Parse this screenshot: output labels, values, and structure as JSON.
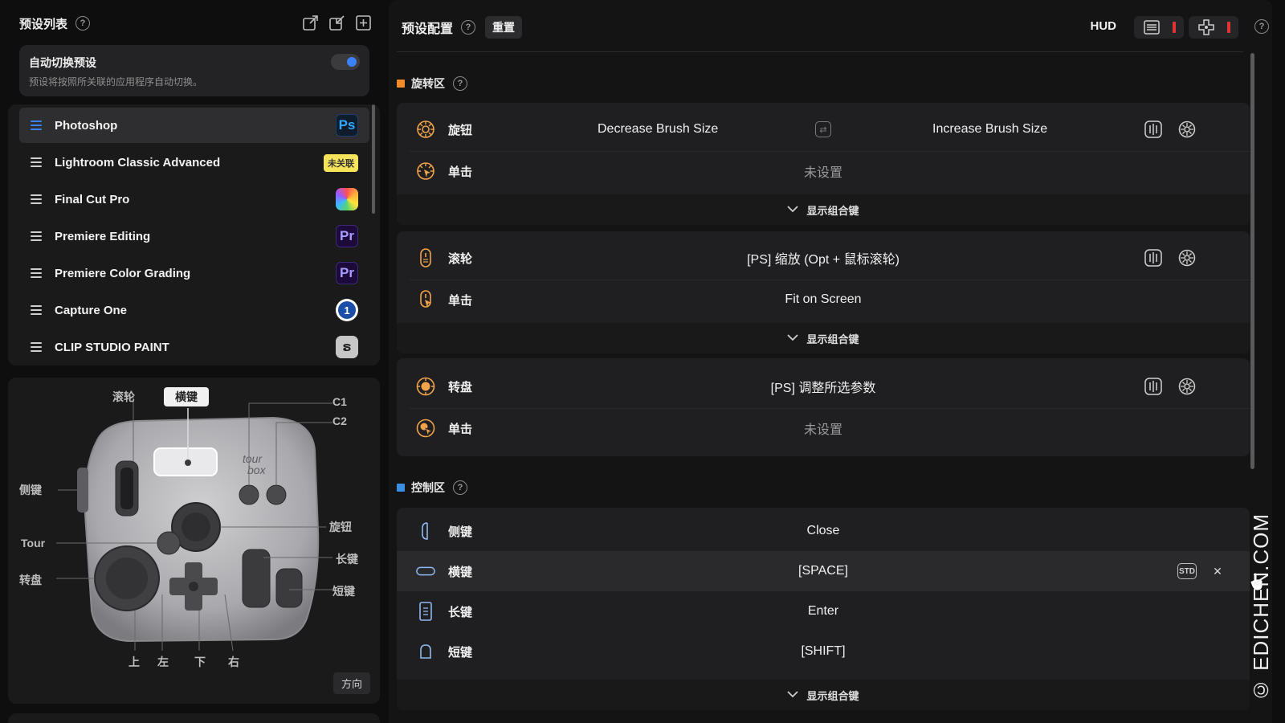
{
  "left": {
    "title": "预设列表",
    "help": "?",
    "auto_switch": {
      "title": "自动切换预设",
      "desc": "预设将按照所关联的应用程序自动切换。",
      "enabled": true
    },
    "presets": [
      {
        "name": "Photoshop",
        "app": "Ps",
        "active": true
      },
      {
        "name": "Lightroom Classic Advanced",
        "tag": "未关联"
      },
      {
        "name": "Final Cut Pro",
        "app": ""
      },
      {
        "name": "Premiere Editing",
        "app": "Pr"
      },
      {
        "name": "Premiere Color Grading",
        "app": "Pr"
      },
      {
        "name": "Capture One",
        "app": "1"
      },
      {
        "name": "CLIP STUDIO PAINT",
        "app": "ຣ"
      }
    ],
    "device_labels": {
      "scroll": "滚轮",
      "horizontal": "横键",
      "c1": "C1",
      "c2": "C2",
      "side": "侧键",
      "tour": "Tour",
      "dial": "转盘",
      "knob": "旋钮",
      "long": "长键",
      "short": "短键",
      "up": "上",
      "left": "左",
      "down": "下",
      "right": "右",
      "direction": "方向"
    }
  },
  "right": {
    "title": "预设配置",
    "help": "?",
    "reset": "重置",
    "hud": "HUD",
    "rotate_section": {
      "title": "旋转区",
      "color": "#f28c28",
      "knob": {
        "label": "旋钮",
        "left": "Decrease Brush Size",
        "right": "Increase Brush Size"
      },
      "knob_click": {
        "label": "单击",
        "value": "未设置"
      },
      "wheel": {
        "label": "滚轮",
        "value": "[PS] 缩放 (Opt + 鼠标滚轮)"
      },
      "wheel_click": {
        "label": "单击",
        "value": "Fit on Screen"
      },
      "dial": {
        "label": "转盘",
        "value": "[PS] 调整所选参数"
      },
      "dial_click": {
        "label": "单击",
        "value": "未设置"
      }
    },
    "control_section": {
      "title": "控制区",
      "color": "#3b8ee6",
      "side": {
        "label": "侧键",
        "value": "Close"
      },
      "horizontal": {
        "label": "横键",
        "value": "[SPACE]",
        "std": "STD"
      },
      "long": {
        "label": "长键",
        "value": "Enter"
      },
      "short": {
        "label": "短键",
        "value": "[SHIFT]"
      }
    },
    "combo_label": "显示组合键"
  },
  "watermark": "© EDICHEN.COM"
}
